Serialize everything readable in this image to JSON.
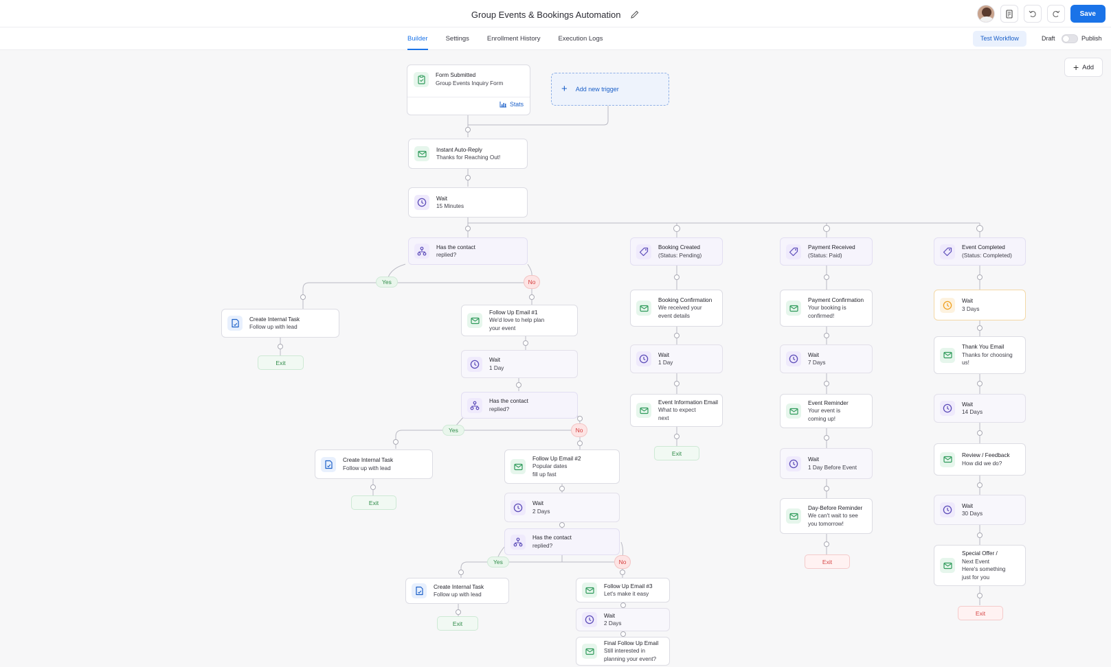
{
  "header": {
    "title": "Group Events & Bookings Automation",
    "save_label": "Save"
  },
  "tabs": [
    "Builder",
    "Settings",
    "Enrollment History",
    "Execution Logs"
  ],
  "toolbar": {
    "test_label": "Test Workflow",
    "draft_label": "Draft",
    "publish_label": "Publish",
    "add_label": "Add"
  },
  "trigger": {
    "title": "Form Submitted",
    "subtitle": "Group Events Inquiry Form",
    "stats_label": "Stats",
    "add_trigger_label": "Add new trigger"
  },
  "nodes": {
    "auto_reply": [
      "Instant Auto-Reply",
      "Thanks for Reaching Out!"
    ],
    "wait_15": [
      "Wait",
      "15 Minutes"
    ],
    "cond_1": [
      "Has the contact",
      "replied?"
    ],
    "task_1": [
      "Create Internal Task",
      "Follow up with lead"
    ],
    "fu1": [
      "Follow Up Email #1",
      "We'd love to help plan",
      "your event"
    ],
    "wait_1d": [
      "Wait",
      "1 Day"
    ],
    "cond_2": [
      "Has the contact",
      "replied?"
    ],
    "task_2": [
      "Create Internal Task",
      "Follow up with lead"
    ],
    "fu2": [
      "Follow Up Email #2",
      "Popular dates",
      "fill up fast"
    ],
    "wait_2d": [
      "Wait",
      "2 Days"
    ],
    "cond_3": [
      "Has the contact",
      "replied?"
    ],
    "task_3": [
      "Create Internal Task",
      "Follow up with lead"
    ],
    "fu3": [
      "Follow Up Email #3",
      "Let's make it easy"
    ],
    "wait_2d_b": [
      "Wait",
      "2 Days"
    ],
    "final": [
      "Final Follow Up Email",
      "Still interested in",
      "planning your event?"
    ],
    "booking": [
      "Booking Created",
      "(Status: Pending)"
    ],
    "booking_conf": [
      "Booking Confirmation",
      "We received your",
      "event details"
    ],
    "b_wait": [
      "Wait",
      "1 Day"
    ],
    "event_info": [
      "Event Information Email",
      "What to expect",
      "next"
    ],
    "payment": [
      "Payment Received",
      "(Status: Paid)"
    ],
    "pay_conf": [
      "Payment Confirmation",
      "Your booking is",
      "confirmed!"
    ],
    "p_wait7": [
      "Wait",
      "7 Days"
    ],
    "reminder": [
      "Event Reminder",
      "Your event is",
      "coming up!"
    ],
    "p_wait_before": [
      "Wait",
      "1 Day Before Event"
    ],
    "day_before": [
      "Day-Before Reminder",
      "We can't wait to see",
      "you tomorrow!"
    ],
    "completed": [
      "Event Completed",
      "(Status: Completed)"
    ],
    "c_wait3": [
      "Wait",
      "3 Days"
    ],
    "thanks": [
      "Thank You Email",
      "Thanks for choosing",
      "us!"
    ],
    "c_wait14": [
      "Wait",
      "14 Days"
    ],
    "review": [
      "Review / Feedback",
      "How did we do?"
    ],
    "c_wait30": [
      "Wait",
      "30 Days"
    ],
    "offer": [
      "Special Offer /",
      "Next Event",
      "Here's something",
      "just for you"
    ]
  },
  "labels": {
    "yes": "Yes",
    "no": "No",
    "exit": "Exit"
  },
  "colors": {
    "accent": "#1a73e8",
    "email_green": "#2e9a5a",
    "wait_violet": "#5b4bb8",
    "wait_orange": "#f0a020",
    "exit_red": "#d64545"
  }
}
